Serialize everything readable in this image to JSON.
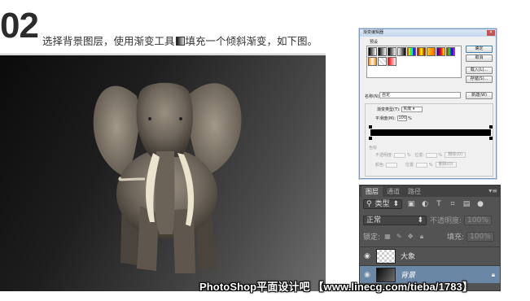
{
  "step": {
    "number": "02",
    "text_before": "选择背景图层，使用渐变工具",
    "text_after": "填充一个倾斜渐变，如下图。"
  },
  "canvas": {
    "gradient_colors": [
      "#0b0b0b",
      "#6e6e6e"
    ],
    "subject": "elephant"
  },
  "gradient_editor": {
    "title": "渐变编辑器",
    "presets_label": "预设",
    "buttons": {
      "ok": "确定",
      "cancel": "取消",
      "load": "载入(L)...",
      "save": "存储(S)...",
      "new": "新建(W)"
    },
    "name_label": "名称(N):",
    "name_value": "自定",
    "gradient_type_label": "渐变类型(T):",
    "gradient_type_value": "实底",
    "smoothness_label": "平滑度(M):",
    "smoothness_value": "100",
    "smoothness_unit": "%",
    "stops_group_label": "色标",
    "opacity_label": "不透明度:",
    "color_label": "颜色:",
    "location_label": "位置:",
    "percent": "%",
    "delete_label": "删除(D)",
    "close_icon": "close-icon"
  },
  "layers_panel": {
    "tabs": [
      "图层",
      "通道",
      "路径"
    ],
    "filter_label": "类型",
    "blend_mode": "正常",
    "opacity_label": "不透明度:",
    "opacity_value": "100%",
    "lock_label": "锁定:",
    "fill_label": "填充:",
    "fill_value": "100%",
    "layers": [
      {
        "name": "大象",
        "visible": true,
        "selected": false
      },
      {
        "name": "背景",
        "visible": true,
        "selected": true,
        "locked": true
      }
    ]
  },
  "watermark": "PhotoShop平面设计吧 【www.linecg.com/tieba/1783】"
}
